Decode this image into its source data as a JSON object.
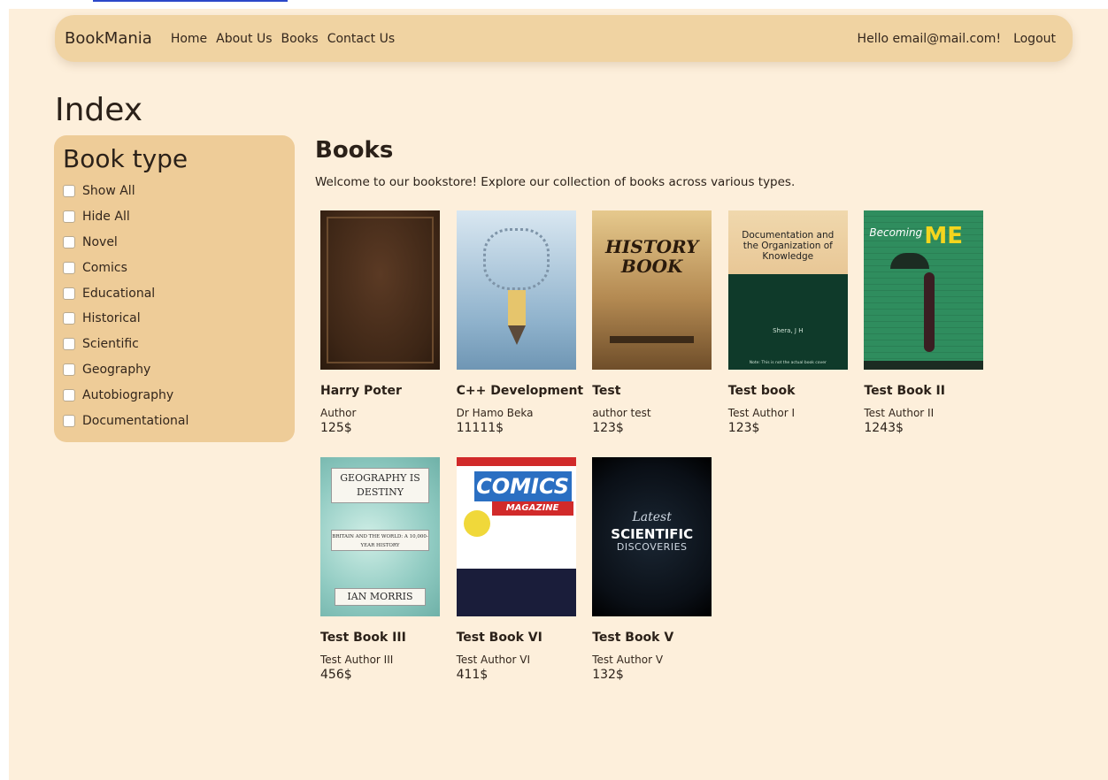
{
  "navbar": {
    "brand": "BookMania",
    "links": [
      "Home",
      "About Us",
      "Books",
      "Contact Us"
    ],
    "greeting": "Hello email@mail.com!",
    "logout": "Logout"
  },
  "page_title": "Index",
  "sidebar": {
    "title": "Book type",
    "filters": [
      "Show All",
      "Hide All",
      "Novel",
      "Comics",
      "Educational",
      "Historical",
      "Scientific",
      "Geography",
      "Autobiography",
      "Documentational"
    ]
  },
  "main": {
    "title": "Books",
    "welcome": "Welcome to our bookstore! Explore our collection of books across various types.",
    "books": [
      {
        "title": "Harry Poter",
        "author": "Author",
        "price": "125$"
      },
      {
        "title": "C++ Development",
        "author": "Dr Hamo Beka",
        "price": "11111$"
      },
      {
        "title": "Test",
        "author": "author test",
        "price": "123$"
      },
      {
        "title": "Test book",
        "author": "Test Author I",
        "price": "123$"
      },
      {
        "title": "Test Book II",
        "author": "Test Author II",
        "price": "1243$"
      },
      {
        "title": "Test Book III",
        "author": "Test Author III",
        "price": "456$"
      },
      {
        "title": "Test Book VI",
        "author": "Test Author VI",
        "price": "411$"
      },
      {
        "title": "Test Book V",
        "author": "Test Author V",
        "price": "132$"
      }
    ]
  },
  "covers": {
    "history": {
      "line1": "HISTORY",
      "line2": "BOOK"
    },
    "doc": {
      "title": "Documentation and the Organization of Knowledge",
      "author": "Shera, J H",
      "note": "Note: This is not the actual book cover"
    },
    "me": {
      "becoming": "Becoming",
      "me": "ME"
    },
    "geo": {
      "title": "GEOGRAPHY IS DESTINY",
      "subtitle": "BRITAIN AND THE WORLD: A 10,000-YEAR HISTORY",
      "author": "IAN MORRIS"
    },
    "comics": {
      "title": "COMICS",
      "sub": "MAGAZINE"
    },
    "sci": {
      "line1": "Latest",
      "line2": "SCIENTIFIC",
      "line3": "DISCOVERIES"
    }
  },
  "colors": {
    "page_bg": "#fdefdb",
    "navbar_bg": "#f0d3a2",
    "sidebar_bg": "#eecc98",
    "text": "#2b2119"
  }
}
